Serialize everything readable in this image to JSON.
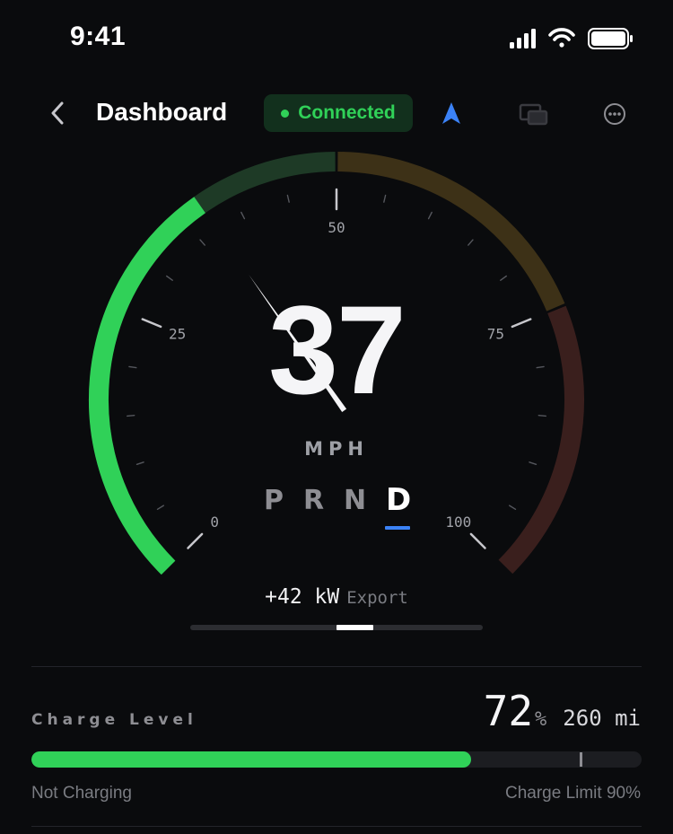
{
  "status_bar": {
    "time": "9:41",
    "icons": [
      "cellular-signal-icon",
      "wifi-icon",
      "battery-icon"
    ]
  },
  "header": {
    "title": "Dashboard",
    "connection": {
      "label": "Connected",
      "color": "#30d158"
    },
    "icons": [
      "back-chevron-icon",
      "navigation-arrow-icon",
      "cast-screen-icon",
      "more-ellipsis-icon"
    ],
    "nav_color": "#3b82f6"
  },
  "gauge": {
    "speed": "37",
    "unit": "MPH",
    "min": 0,
    "max": 100,
    "tick_labels": [
      "0",
      "25",
      "50",
      "75",
      "100"
    ],
    "colors": {
      "active": "#30d158",
      "green_zone": "#1e3a26",
      "amber_zone": "#3d3117",
      "red_zone": "#3a1f1d"
    }
  },
  "gears": {
    "items": [
      "P",
      "R",
      "N",
      "D"
    ],
    "selected": "D"
  },
  "power": {
    "value": "+42 kW",
    "label": "Export",
    "level_fraction": 0.125
  },
  "charge": {
    "label": "Charge Level",
    "percent": "72",
    "percent_sign": "%",
    "range": "260 mi",
    "state": "Not Charging",
    "limit_label": "Charge Limit 90%",
    "level": 72,
    "limit": 90
  }
}
